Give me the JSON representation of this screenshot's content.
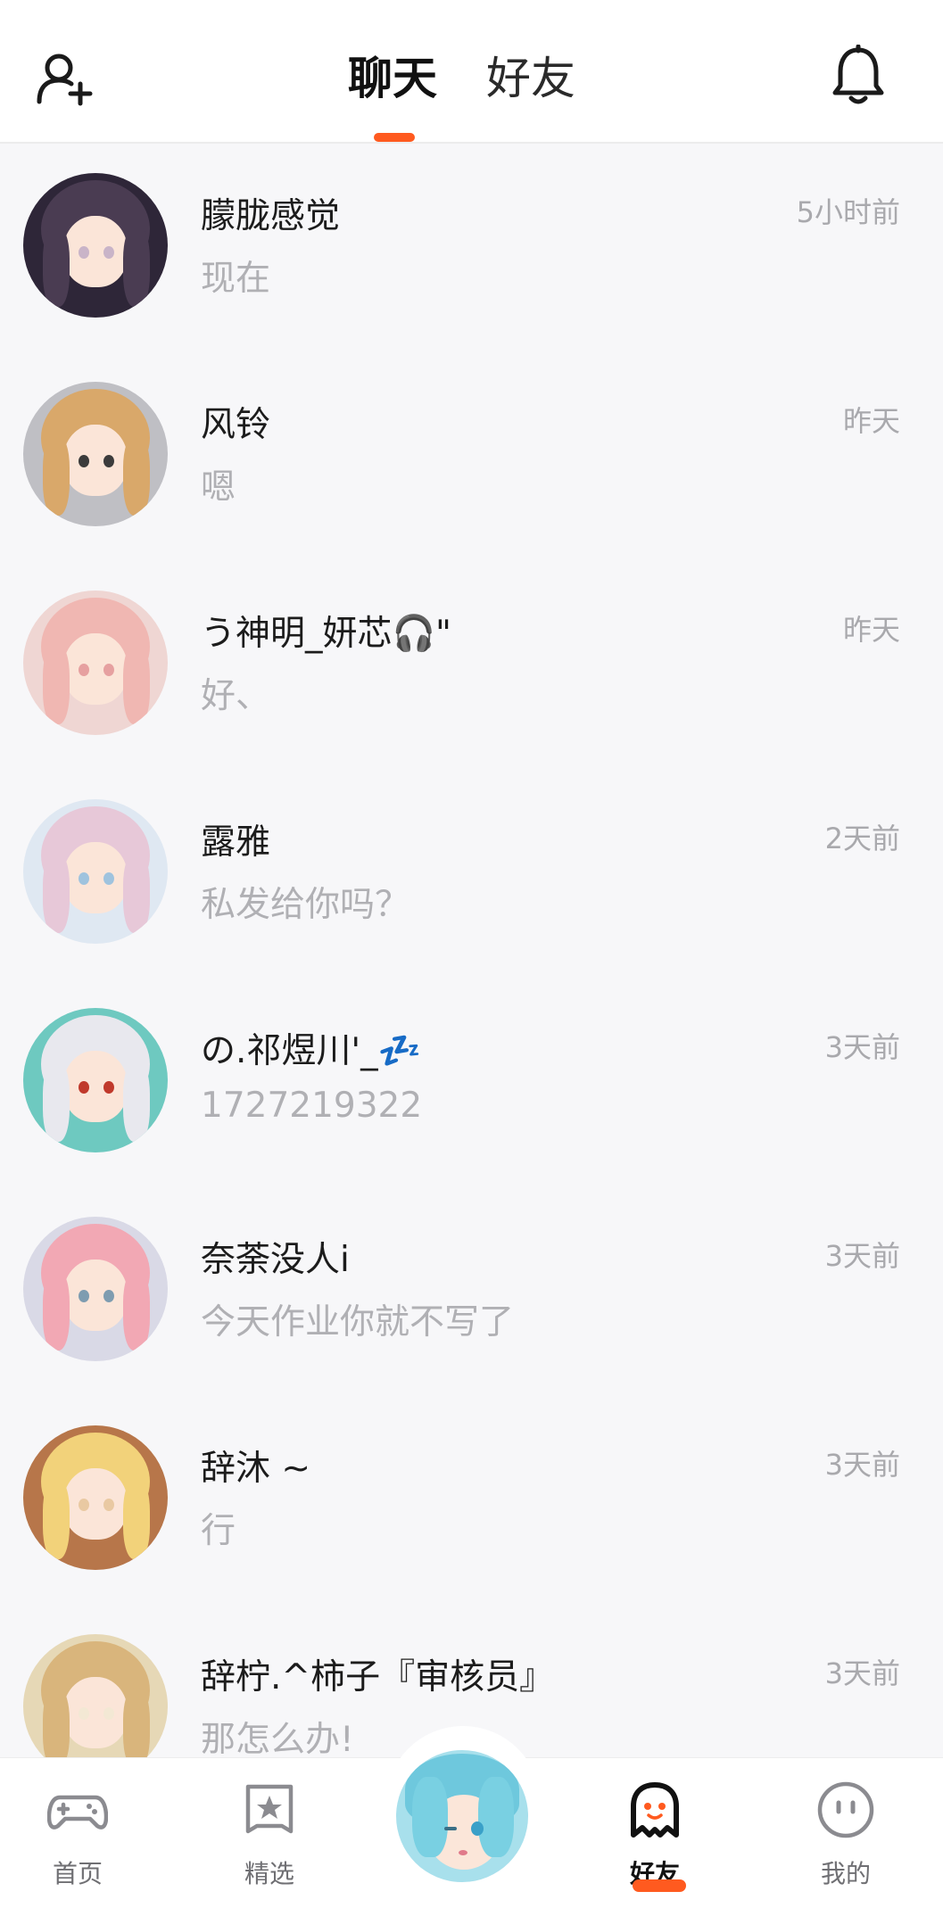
{
  "header": {
    "tabs": [
      {
        "label": "聊天",
        "active": true
      },
      {
        "label": "好友",
        "active": false
      }
    ],
    "add_friend_icon": "add-friend-icon",
    "notification_icon": "bell-icon",
    "accent_color": "#ff5a1f"
  },
  "conversations": [
    {
      "name": "朦胧感觉",
      "time": "5小时前",
      "message": "现在",
      "avatar_colors": [
        "#2e2638",
        "#4a3c52",
        "#c9b4c8"
      ]
    },
    {
      "name": "风铃",
      "time": "昨天",
      "message": "嗯",
      "avatar_colors": [
        "#bfbfc4",
        "#d9a86a",
        "#3b3b3b"
      ]
    },
    {
      "name": "う神明_妍芯🎧\"",
      "time": "昨天",
      "message": "好、",
      "avatar_colors": [
        "#efd6d3",
        "#f0b7b2",
        "#e6a0a0"
      ]
    },
    {
      "name": "露雅",
      "time": "2天前",
      "message": "私发给你吗？",
      "avatar_colors": [
        "#dfe8f2",
        "#e7c8d8",
        "#9fc3de"
      ]
    },
    {
      "name": "の.祁煜川'_💤",
      "time": "3天前",
      "message": "1727219322",
      "avatar_colors": [
        "#6ec9c0",
        "#e8e8ee",
        "#c0392b"
      ]
    },
    {
      "name": "奈荼没人i",
      "time": "3天前",
      "message": "今天作业你就不写了",
      "avatar_colors": [
        "#d9d9e6",
        "#f2a8b4",
        "#7e9cb0"
      ]
    },
    {
      "name": "辞沐 ~",
      "time": "3天前",
      "message": "行",
      "avatar_colors": [
        "#b7764a",
        "#f2d27a",
        "#e9c9a2"
      ]
    },
    {
      "name": "辞柠.^柿子『审核员』",
      "time": "3天前",
      "message": "那怎么办!",
      "avatar_colors": [
        "#e6d8b6",
        "#d9b57c",
        "#f3e8d4"
      ]
    }
  ],
  "bottom_nav": [
    {
      "label": "首页",
      "icon": "gamepad-icon",
      "active": false
    },
    {
      "label": "精选",
      "icon": "star-bookmark-icon",
      "active": false
    },
    {
      "label": "",
      "icon": "profile-avatar",
      "active": false
    },
    {
      "label": "好友",
      "icon": "ghost-icon",
      "active": true
    },
    {
      "label": "我的",
      "icon": "smiley-icon",
      "active": false
    }
  ]
}
